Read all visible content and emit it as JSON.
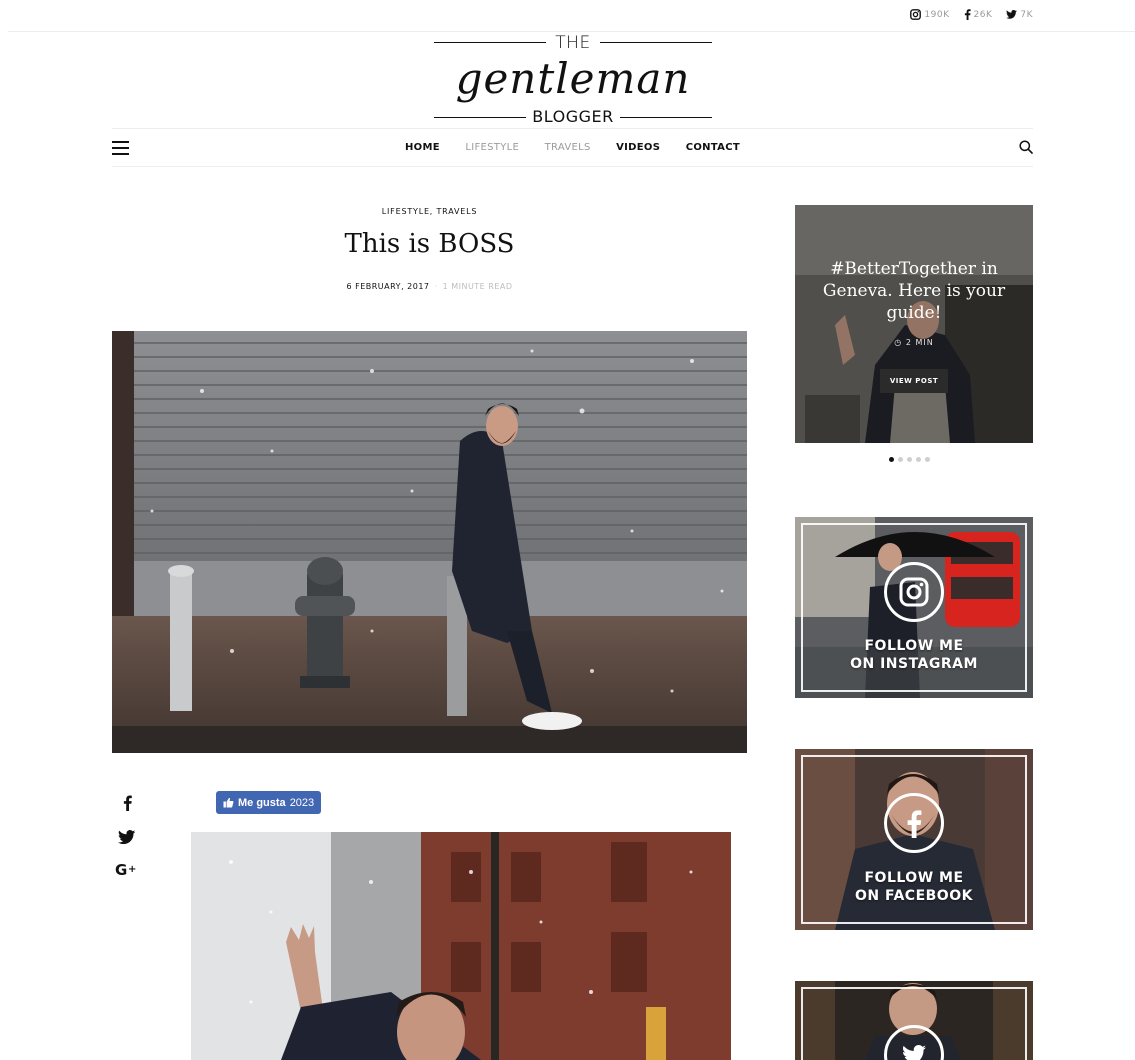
{
  "topbar": {
    "social": [
      {
        "icon": "instagram-icon",
        "count": "190K"
      },
      {
        "icon": "facebook-icon",
        "count": "26K"
      },
      {
        "icon": "twitter-icon",
        "count": "7K"
      }
    ]
  },
  "logo": {
    "the": "THE",
    "script": "gentleman",
    "blogger": "BLOGGER"
  },
  "nav": {
    "items": [
      {
        "label": "HOME",
        "active": true
      },
      {
        "label": "LIFESTYLE",
        "active": false
      },
      {
        "label": "TRAVELS",
        "active": false
      },
      {
        "label": "VIDEOS",
        "active": true
      },
      {
        "label": "CONTACT",
        "active": true
      }
    ],
    "menu_icon": "hamburger-menu-icon",
    "search_icon": "search-icon"
  },
  "post": {
    "categories": "LIFESTYLE, TRAVELS",
    "title": "This is BOSS",
    "date": "6 FEBRUARY, 2017",
    "separator": "·",
    "read_time": "1 MINUTE READ",
    "like_label": "Me gusta",
    "like_count": "2023"
  },
  "share": [
    {
      "icon": "facebook-icon"
    },
    {
      "icon": "twitter-icon"
    },
    {
      "icon": "google-plus-icon"
    }
  ],
  "sidebar": {
    "slider": {
      "title": "#BetterTogether in Geneva. Here is your guide!",
      "time": "2 MIN",
      "button": "VIEW POST",
      "dots": 5,
      "active_dot": 0
    },
    "instagram": {
      "line1": "FOLLOW ME",
      "line2": "ON INSTAGRAM"
    },
    "facebook": {
      "line1": "FOLLOW ME",
      "line2": "ON FACEBOOK"
    }
  },
  "colors": {
    "accent": "#111111",
    "muted": "#9b9b9b",
    "facebook_blue": "#4267b2"
  }
}
